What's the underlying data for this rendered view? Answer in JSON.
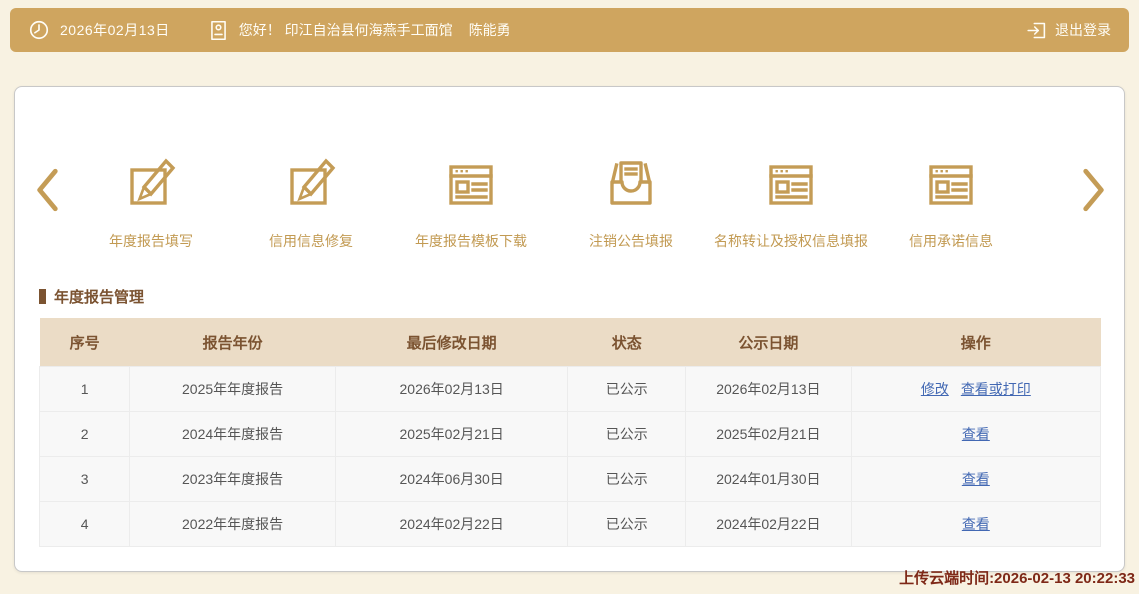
{
  "topbar": {
    "date": "2026年02月13日",
    "greeting": "您好！ 印江自治县何海燕手工面馆",
    "username": "陈能勇",
    "logout_label": "退出登录"
  },
  "carousel": {
    "items": [
      {
        "label": "年度报告填写",
        "icon": "edit-icon"
      },
      {
        "label": "信用信息修复",
        "icon": "edit-icon"
      },
      {
        "label": "年度报告模板下载",
        "icon": "template-icon"
      },
      {
        "label": "注销公告填报",
        "icon": "inbox-icon"
      },
      {
        "label": "名称转让及授权信息填报",
        "icon": "template-icon"
      },
      {
        "label": "信用承诺信息",
        "icon": "template-icon"
      }
    ]
  },
  "section": {
    "title": "年度报告管理"
  },
  "table": {
    "headers": [
      "序号",
      "报告年份",
      "最后修改日期",
      "状态",
      "公示日期",
      "操作"
    ],
    "rows": [
      {
        "index": "1",
        "year": "2025年年度报告",
        "modified": "2026年02月13日",
        "status": "已公示",
        "publish": "2026年02月13日",
        "action_edit": "修改",
        "action_view": "查看或打印"
      },
      {
        "index": "2",
        "year": "2024年年度报告",
        "modified": "2025年02月21日",
        "status": "已公示",
        "publish": "2025年02月21日",
        "action_view": "查看"
      },
      {
        "index": "3",
        "year": "2023年年度报告",
        "modified": "2024年06月30日",
        "status": "已公示",
        "publish": "2024年01月30日",
        "action_view": "查看"
      },
      {
        "index": "4",
        "year": "2022年年度报告",
        "modified": "2024年02月22日",
        "status": "已公示",
        "publish": "2024年02月22日",
        "action_view": "查看"
      }
    ]
  },
  "footer": {
    "upload_time": "上传云端时间:2026-02-13 20:22:33"
  },
  "colors": {
    "topbar_bg": "#cfa55f",
    "page_bg": "#f8f2e2",
    "gold_icon": "#c49c56",
    "header_bg": "#ebdcc6",
    "header_text": "#7b5331",
    "link_blue": "#4268b3",
    "footer_red": "#7e2817"
  }
}
